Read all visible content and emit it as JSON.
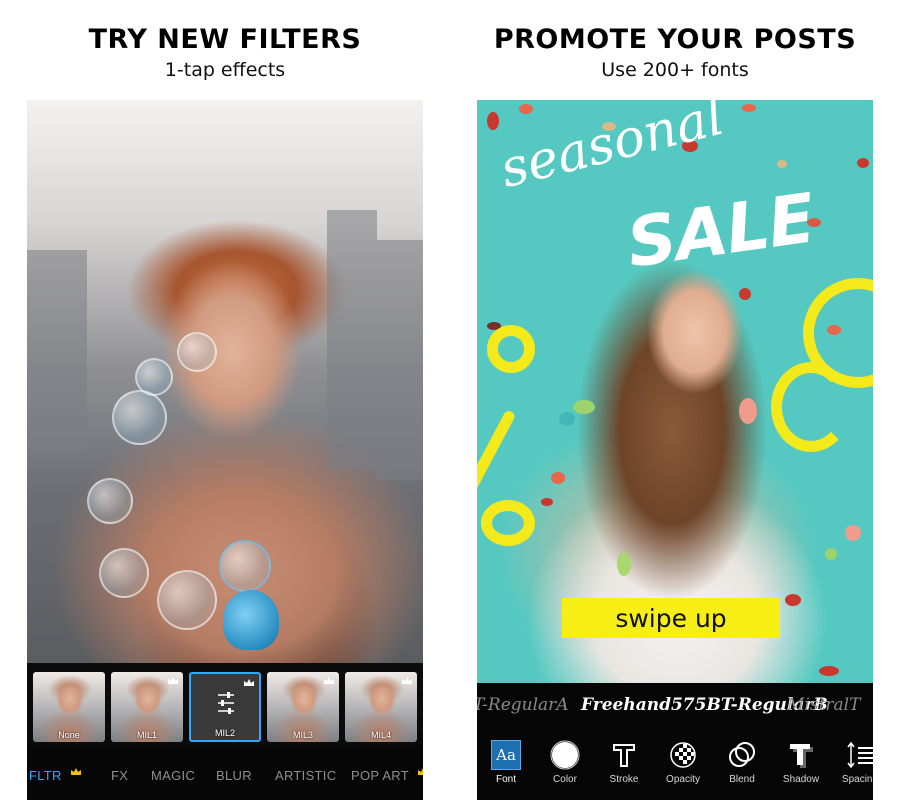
{
  "left_panel": {
    "headline": "TRY NEW FILTERS",
    "subheadline": "1-tap effects",
    "thumbnails": [
      {
        "label": "None",
        "premium": false,
        "selected": false
      },
      {
        "label": "MIL1",
        "premium": true,
        "selected": false
      },
      {
        "label": "MIL2",
        "premium": true,
        "selected": true
      },
      {
        "label": "MIL3",
        "premium": true,
        "selected": false
      },
      {
        "label": "MIL4",
        "premium": true,
        "selected": false
      }
    ],
    "tabs": [
      {
        "label": "FLTR",
        "active": true
      },
      {
        "label": "FX",
        "active": false
      },
      {
        "label": "MAGIC",
        "active": false
      },
      {
        "label": "BLUR",
        "active": false
      },
      {
        "label": "ARTISTIC",
        "active": false
      },
      {
        "label": "POP ART",
        "active": false
      }
    ]
  },
  "right_panel": {
    "headline": "PROMOTE YOUR POSTS",
    "subheadline": "Use 200+ fonts",
    "poster": {
      "script_text": "seasonal",
      "bold_text": "SALE",
      "banner_text": "swipe up"
    },
    "font_samples": [
      {
        "label": "T-RegularA",
        "active": false
      },
      {
        "label": "Freehand575BT-RegularB",
        "active": true
      },
      {
        "label": "MistralT",
        "active": false
      }
    ],
    "tools": [
      {
        "label": "Font",
        "icon": "font-icon",
        "active": true
      },
      {
        "label": "Color",
        "icon": "color-icon",
        "active": false
      },
      {
        "label": "Stroke",
        "icon": "stroke-icon",
        "active": false
      },
      {
        "label": "Opacity",
        "icon": "opacity-icon",
        "active": false
      },
      {
        "label": "Blend",
        "icon": "blend-icon",
        "active": false
      },
      {
        "label": "Shadow",
        "icon": "shadow-icon",
        "active": false
      },
      {
        "label": "Spacing",
        "icon": "spacing-icon",
        "active": false
      }
    ],
    "font_icon_glyph": "Aa"
  },
  "colors": {
    "accent_blue": "#2fa8ff",
    "crown_gold": "#f2c200",
    "poster_teal": "#55c9c1",
    "poster_yellow": "#f6ee14"
  }
}
